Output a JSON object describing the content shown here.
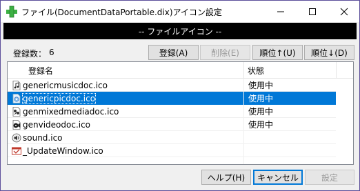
{
  "window": {
    "title": "ファイル(DocumentDataPortable.dix)アイコン設定"
  },
  "band": {
    "title": "-- ファイルアイコン --"
  },
  "count": {
    "label": "登録数：",
    "value": "6"
  },
  "toolbar": {
    "register": "登録(A)",
    "delete": "削除(E)",
    "order_up": "順位↑(U)",
    "order_down": "順位↓(D)"
  },
  "list": {
    "columns": [
      "登録名",
      "状態"
    ],
    "rows": [
      {
        "name": "genericmusicdoc.ico",
        "status": "使用中",
        "icon": "music-doc-icon",
        "selected": false
      },
      {
        "name": "genericpicdoc.ico",
        "status": "使用中",
        "icon": "picture-doc-icon",
        "selected": true
      },
      {
        "name": "genmixedmediadoc.ico",
        "status": "使用中",
        "icon": "mixed-media-doc-icon",
        "selected": false
      },
      {
        "name": "genvideodoc.ico",
        "status": "使用中",
        "icon": "video-doc-icon",
        "selected": false
      },
      {
        "name": "sound.ico",
        "status": "",
        "icon": "sound-icon",
        "selected": false
      },
      {
        "name": "_UpdateWindow.ico",
        "status": "",
        "icon": "update-window-icon",
        "selected": false
      }
    ]
  },
  "footer": {
    "help": "ヘルプ(H)",
    "cancel": "キャンセル",
    "apply": "設定"
  },
  "colors": {
    "selection": "#0078d7",
    "band": "#000000",
    "frame": "#5b4e9a"
  }
}
